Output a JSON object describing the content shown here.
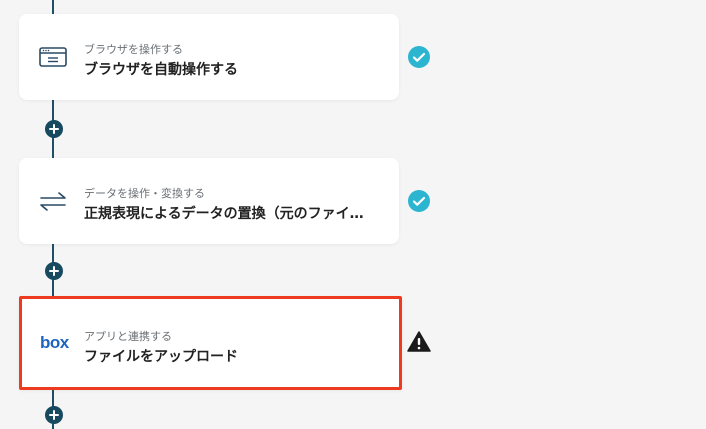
{
  "flow": {
    "steps": [
      {
        "subtitle": "ブラウザを操作する",
        "title": "ブラウザを自動操作する",
        "icon": "browser-window-icon",
        "status": "complete"
      },
      {
        "subtitle": "データを操作・変換する",
        "title": "正規表現によるデータの置換（元のファイ…",
        "icon": "swap-arrows-icon",
        "status": "complete"
      },
      {
        "subtitle": "アプリと連携する",
        "title": "ファイルをアップロード",
        "icon": "box-logo",
        "status": "warning",
        "logo_text": "box"
      }
    ]
  },
  "colors": {
    "connector": "#1f4f66",
    "check": "#2bb5d1",
    "highlight": "#ee3a1e",
    "box_brand": "#1d65c1"
  }
}
